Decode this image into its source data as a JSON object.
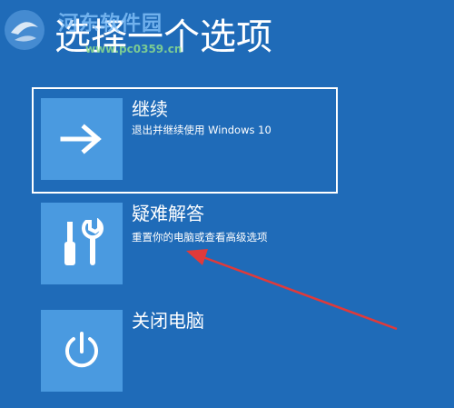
{
  "page": {
    "title": "选择一个选项",
    "background": "#1f6bb8",
    "tile_color": "#4a9ae0"
  },
  "watermark": {
    "text": "河东软件园",
    "url": "www.pc0359.cn",
    "icon": "watermark-logo"
  },
  "options": [
    {
      "title": "继续",
      "description": "退出并继续使用 Windows 10",
      "icon": "arrow-right-icon",
      "selected": true
    },
    {
      "title": "疑难解答",
      "description": "重置你的电脑或查看高级选项",
      "icon": "tools-icon",
      "selected": false
    },
    {
      "title": "关闭电脑",
      "description": "",
      "icon": "power-icon",
      "selected": false
    }
  ],
  "annotation": {
    "type": "red-arrow",
    "color": "#e03a3a",
    "points_to": "疑难解答"
  }
}
